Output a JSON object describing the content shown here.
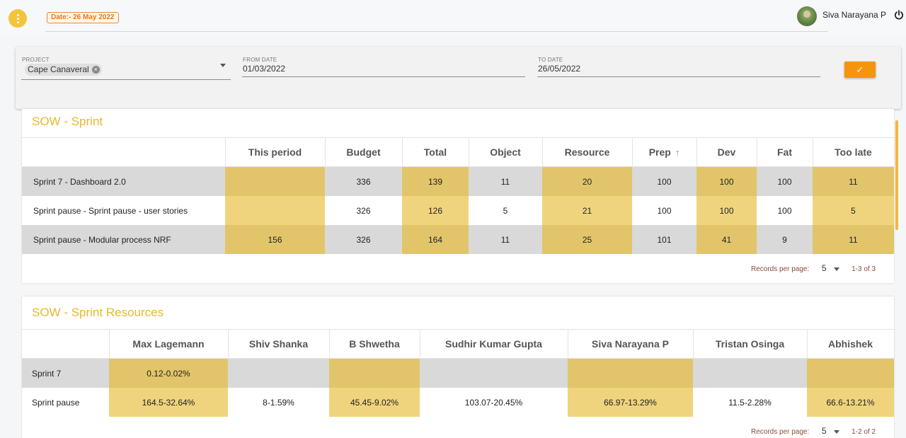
{
  "header": {
    "date_badge": "Date:- 26 May 2022",
    "user_name": "Siva Narayana P"
  },
  "filter": {
    "project_label": "PROJECT",
    "project_value": "Cape Canaveral",
    "from_label": "FROM DATE",
    "from_value": "01/03/2022",
    "to_label": "TO DATE",
    "to_value": "26/05/2022",
    "submit_icon": "✓"
  },
  "sprint": {
    "title": "SOW - Sprint",
    "columns": [
      "",
      "This period",
      "Budget",
      "Total",
      "Object",
      "Resource",
      "Prep",
      "Dev",
      "Fat",
      "Too late"
    ],
    "sort_icon": "↑",
    "rows": [
      [
        "Sprint 7 - Dashboard 2.0",
        "",
        "336",
        "139",
        "11",
        "20",
        "100",
        "100",
        "100",
        "11"
      ],
      [
        "Sprint pause  - Sprint pause - user stories",
        "",
        "326",
        "126",
        "5",
        "21",
        "100",
        "100",
        "100",
        "5"
      ],
      [
        "Sprint pause  - Modular process NRF",
        "156",
        "326",
        "164",
        "11",
        "25",
        "101",
        "41",
        "9",
        "11"
      ]
    ],
    "records_label": "Records per page:",
    "records_value": "5",
    "range": "1-3 of 3"
  },
  "resources": {
    "title": "SOW - Sprint Resources",
    "columns": [
      "",
      "Max Lagemann",
      "Shiv Shanka",
      "B Shwetha",
      "Sudhir Kumar Gupta",
      "Siva Narayana P",
      "Tristan Osinga",
      "Abhishek"
    ],
    "rows": [
      [
        "Sprint 7",
        "0.12-0.02%",
        "",
        "",
        "",
        "",
        "",
        ""
      ],
      [
        "Sprint pause",
        "164.5-32.64%",
        "8-1.59%",
        "45.45-9.02%",
        "103.07-20.45%",
        "66.97-13.29%",
        "11.5-2.28%",
        "66.6-13.21%"
      ]
    ],
    "records_label": "Records per page:",
    "records_value": "5",
    "range": "1-2 of 2"
  }
}
